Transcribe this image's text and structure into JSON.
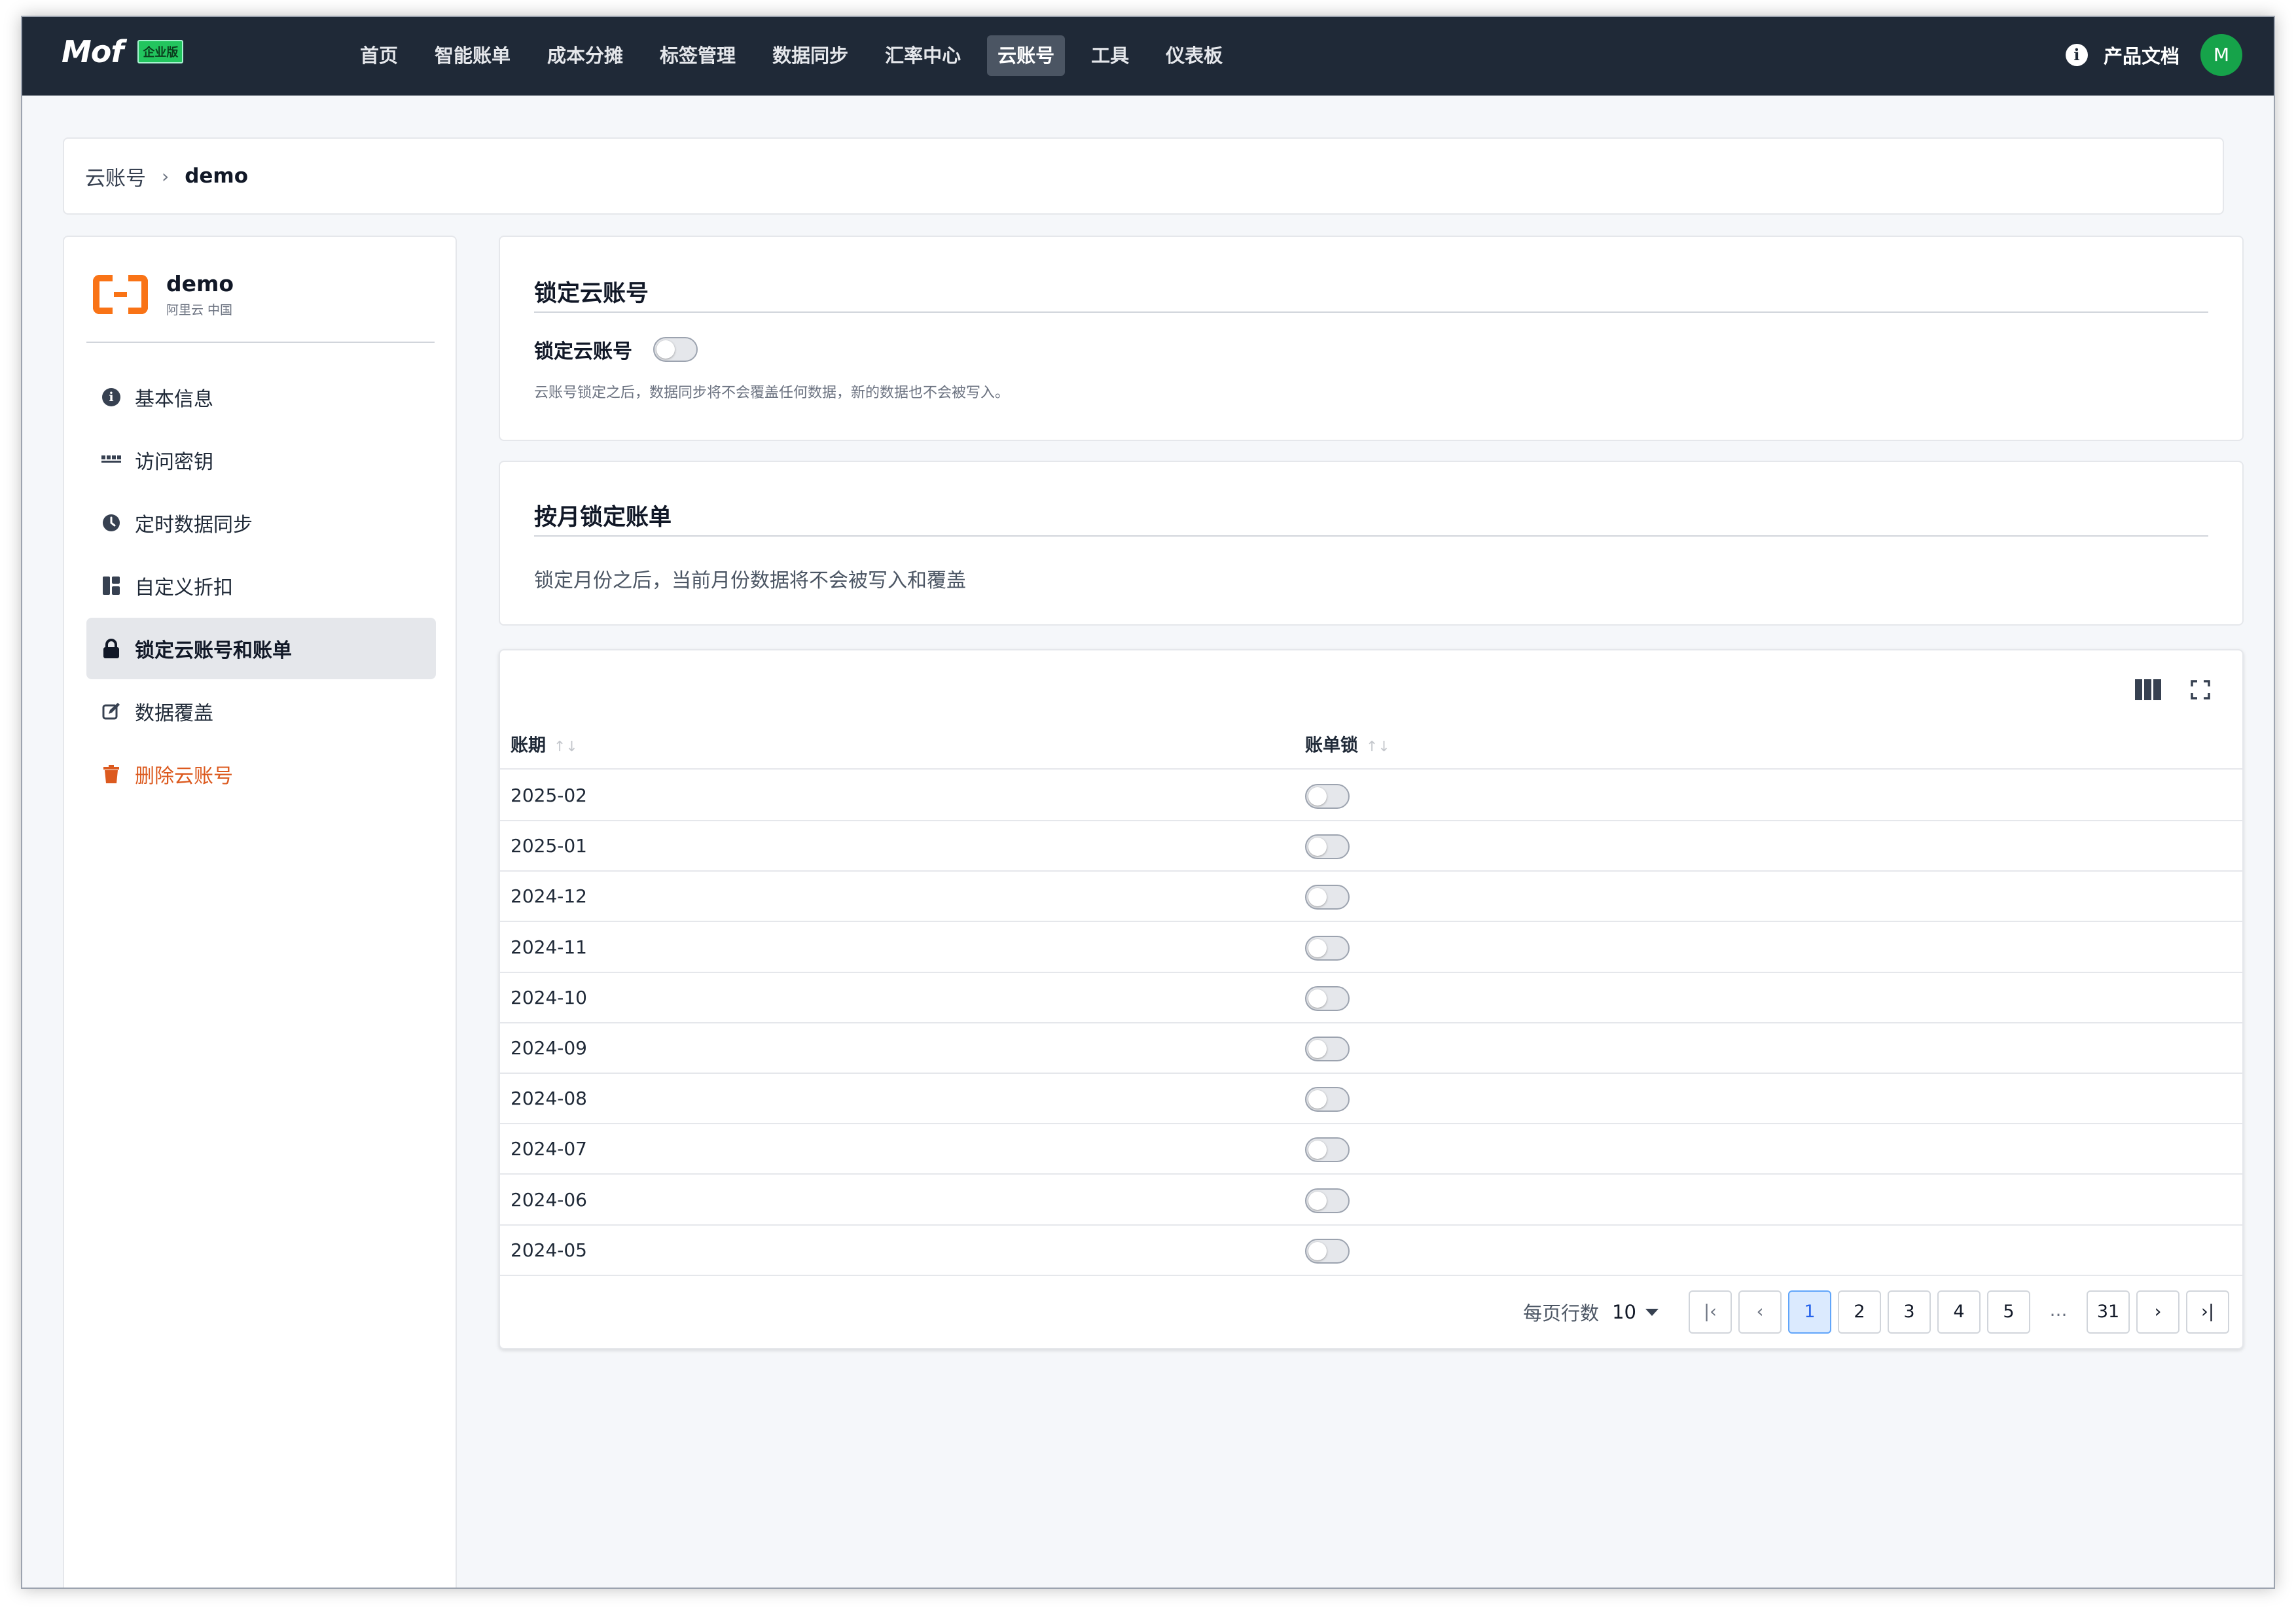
{
  "app": {
    "logo": "Mof",
    "edition": "企业版"
  },
  "nav": {
    "items": [
      "首页",
      "智能账单",
      "成本分摊",
      "标签管理",
      "数据同步",
      "汇率中心",
      "云账号",
      "工具",
      "仪表板"
    ],
    "active_index": 6,
    "docs_label": "产品文档",
    "avatar_initial": "M"
  },
  "breadcrumb": {
    "parent": "云账号",
    "separator": "›",
    "current": "demo"
  },
  "account": {
    "name": "demo",
    "provider": "阿里云 中国"
  },
  "sidebar": {
    "items": [
      {
        "label": "基本信息",
        "icon": "info-icon"
      },
      {
        "label": "访问密钥",
        "icon": "key-icon"
      },
      {
        "label": "定时数据同步",
        "icon": "clock-icon"
      },
      {
        "label": "自定义折扣",
        "icon": "discount-icon"
      },
      {
        "label": "锁定云账号和账单",
        "icon": "lock-icon"
      },
      {
        "label": "数据覆盖",
        "icon": "edit-icon"
      },
      {
        "label": "删除云账号",
        "icon": "trash-icon"
      }
    ],
    "active_index": 4
  },
  "lock_account": {
    "title": "锁定云账号",
    "toggle_label": "锁定云账号",
    "toggle_on": false,
    "help": "云账号锁定之后，数据同步将不会覆盖任何数据，新的数据也不会被写入。"
  },
  "monthly_lock": {
    "title": "按月锁定账单",
    "description": "锁定月份之后，当前月份数据将不会被写入和覆盖"
  },
  "table": {
    "columns": [
      "账期",
      "账单锁"
    ],
    "rows": [
      {
        "period": "2025-02",
        "locked": false
      },
      {
        "period": "2025-01",
        "locked": false
      },
      {
        "period": "2024-12",
        "locked": false
      },
      {
        "period": "2024-11",
        "locked": false
      },
      {
        "period": "2024-10",
        "locked": false
      },
      {
        "period": "2024-09",
        "locked": false
      },
      {
        "period": "2024-08",
        "locked": false
      },
      {
        "period": "2024-07",
        "locked": false
      },
      {
        "period": "2024-06",
        "locked": false
      },
      {
        "period": "2024-05",
        "locked": false
      }
    ]
  },
  "pagination": {
    "rows_per_page_label": "每页行数",
    "rows_per_page": "10",
    "pages": [
      "1",
      "2",
      "3",
      "4",
      "5"
    ],
    "ellipsis": "…",
    "last_page": "31",
    "current": "1"
  },
  "colors": {
    "topbar": "#1f2937",
    "danger": "#dc5a1f",
    "accent": "#2563eb",
    "brand_logo": "#f97316"
  }
}
